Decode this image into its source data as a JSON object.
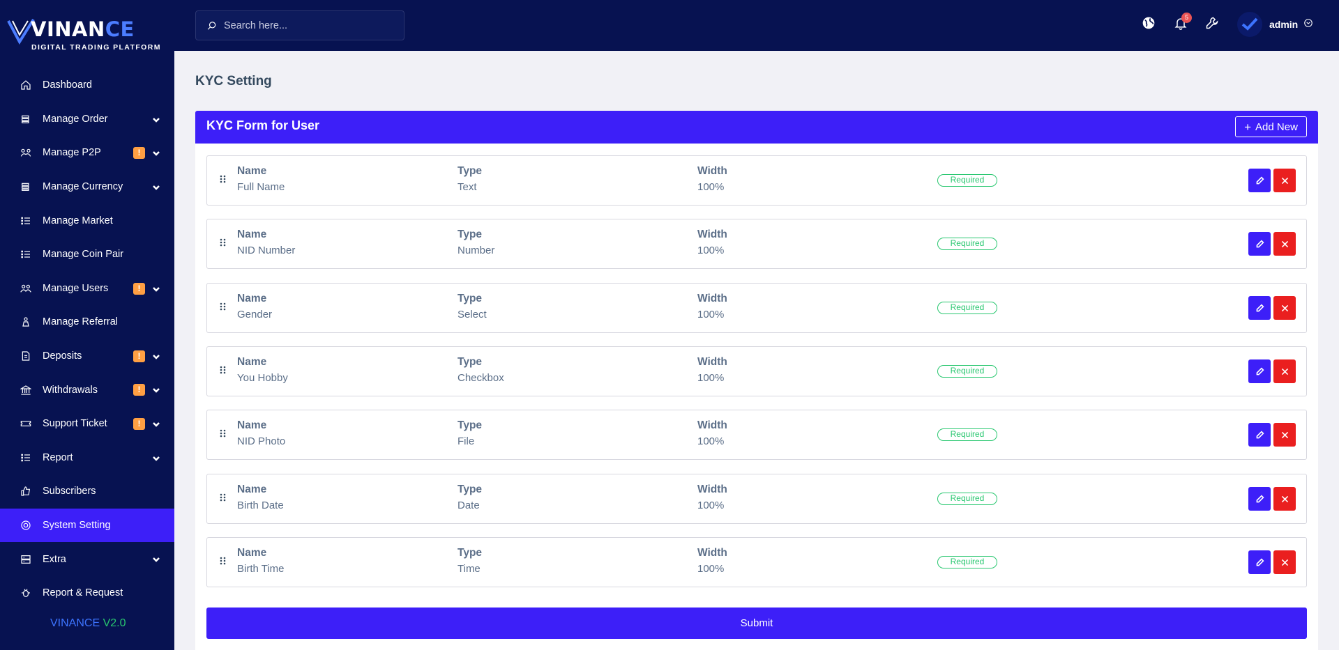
{
  "brand": {
    "name_part1": "VINAN",
    "name_part2": "CE",
    "tagline": "DIGITAL TRADING PLATFORM"
  },
  "version": {
    "name": "VINANCE",
    "number": "V2.0"
  },
  "sidebar": {
    "items": [
      {
        "label": "Dashboard",
        "icon": "home-icon",
        "badge": "",
        "chevron": false,
        "active": false
      },
      {
        "label": "Manage Order",
        "icon": "order-icon",
        "badge": "",
        "chevron": true,
        "active": false
      },
      {
        "label": "Manage P2P",
        "icon": "p2p-icon",
        "badge": "!",
        "chevron": true,
        "active": false
      },
      {
        "label": "Manage Currency",
        "icon": "currency-icon",
        "badge": "",
        "chevron": true,
        "active": false
      },
      {
        "label": "Manage Market",
        "icon": "list-icon",
        "badge": "",
        "chevron": false,
        "active": false
      },
      {
        "label": "Manage Coin Pair",
        "icon": "list-icon",
        "badge": "",
        "chevron": false,
        "active": false
      },
      {
        "label": "Manage Users",
        "icon": "users-icon",
        "badge": "!",
        "chevron": true,
        "active": false
      },
      {
        "label": "Manage Referral",
        "icon": "referral-icon",
        "badge": "",
        "chevron": false,
        "active": false
      },
      {
        "label": "Deposits",
        "icon": "deposit-icon",
        "badge": "!",
        "chevron": true,
        "active": false
      },
      {
        "label": "Withdrawals",
        "icon": "bank-icon",
        "badge": "!",
        "chevron": true,
        "active": false
      },
      {
        "label": "Support Ticket",
        "icon": "ticket-icon",
        "badge": "!",
        "chevron": true,
        "active": false
      },
      {
        "label": "Report",
        "icon": "list-icon",
        "badge": "",
        "chevron": true,
        "active": false
      },
      {
        "label": "Subscribers",
        "icon": "thumbs-up-icon",
        "badge": "",
        "chevron": false,
        "active": false
      },
      {
        "label": "System Setting",
        "icon": "settings-icon",
        "badge": "",
        "chevron": false,
        "active": true
      },
      {
        "label": "Extra",
        "icon": "server-icon",
        "badge": "",
        "chevron": true,
        "active": false
      },
      {
        "label": "Report & Request",
        "icon": "bug-icon",
        "badge": "",
        "chevron": false,
        "active": false
      }
    ]
  },
  "header": {
    "search_placeholder": "Search here...",
    "notification_count": "5",
    "user_name": "admin"
  },
  "page": {
    "title": "KYC Setting",
    "card_title": "KYC Form for User",
    "add_new_label": "Add New",
    "submit_label": "Submit",
    "column_labels": {
      "name": "Name",
      "type": "Type",
      "width": "Width"
    },
    "fields": [
      {
        "name": "Full Name",
        "type": "Text",
        "width": "100%",
        "status": "Required"
      },
      {
        "name": "NID Number",
        "type": "Number",
        "width": "100%",
        "status": "Required"
      },
      {
        "name": "Gender",
        "type": "Select",
        "width": "100%",
        "status": "Required"
      },
      {
        "name": "You Hobby",
        "type": "Checkbox",
        "width": "100%",
        "status": "Required"
      },
      {
        "name": "NID Photo",
        "type": "File",
        "width": "100%",
        "status": "Required"
      },
      {
        "name": "Birth Date",
        "type": "Date",
        "width": "100%",
        "status": "Required"
      },
      {
        "name": "Birth Time",
        "type": "Time",
        "width": "100%",
        "status": "Required"
      }
    ]
  },
  "colors": {
    "sidebar_bg": "#071251",
    "accent": "#3d1ff8",
    "warning_badge": "#ff9f43",
    "success": "#28c76f",
    "danger": "#ea1f1f"
  }
}
